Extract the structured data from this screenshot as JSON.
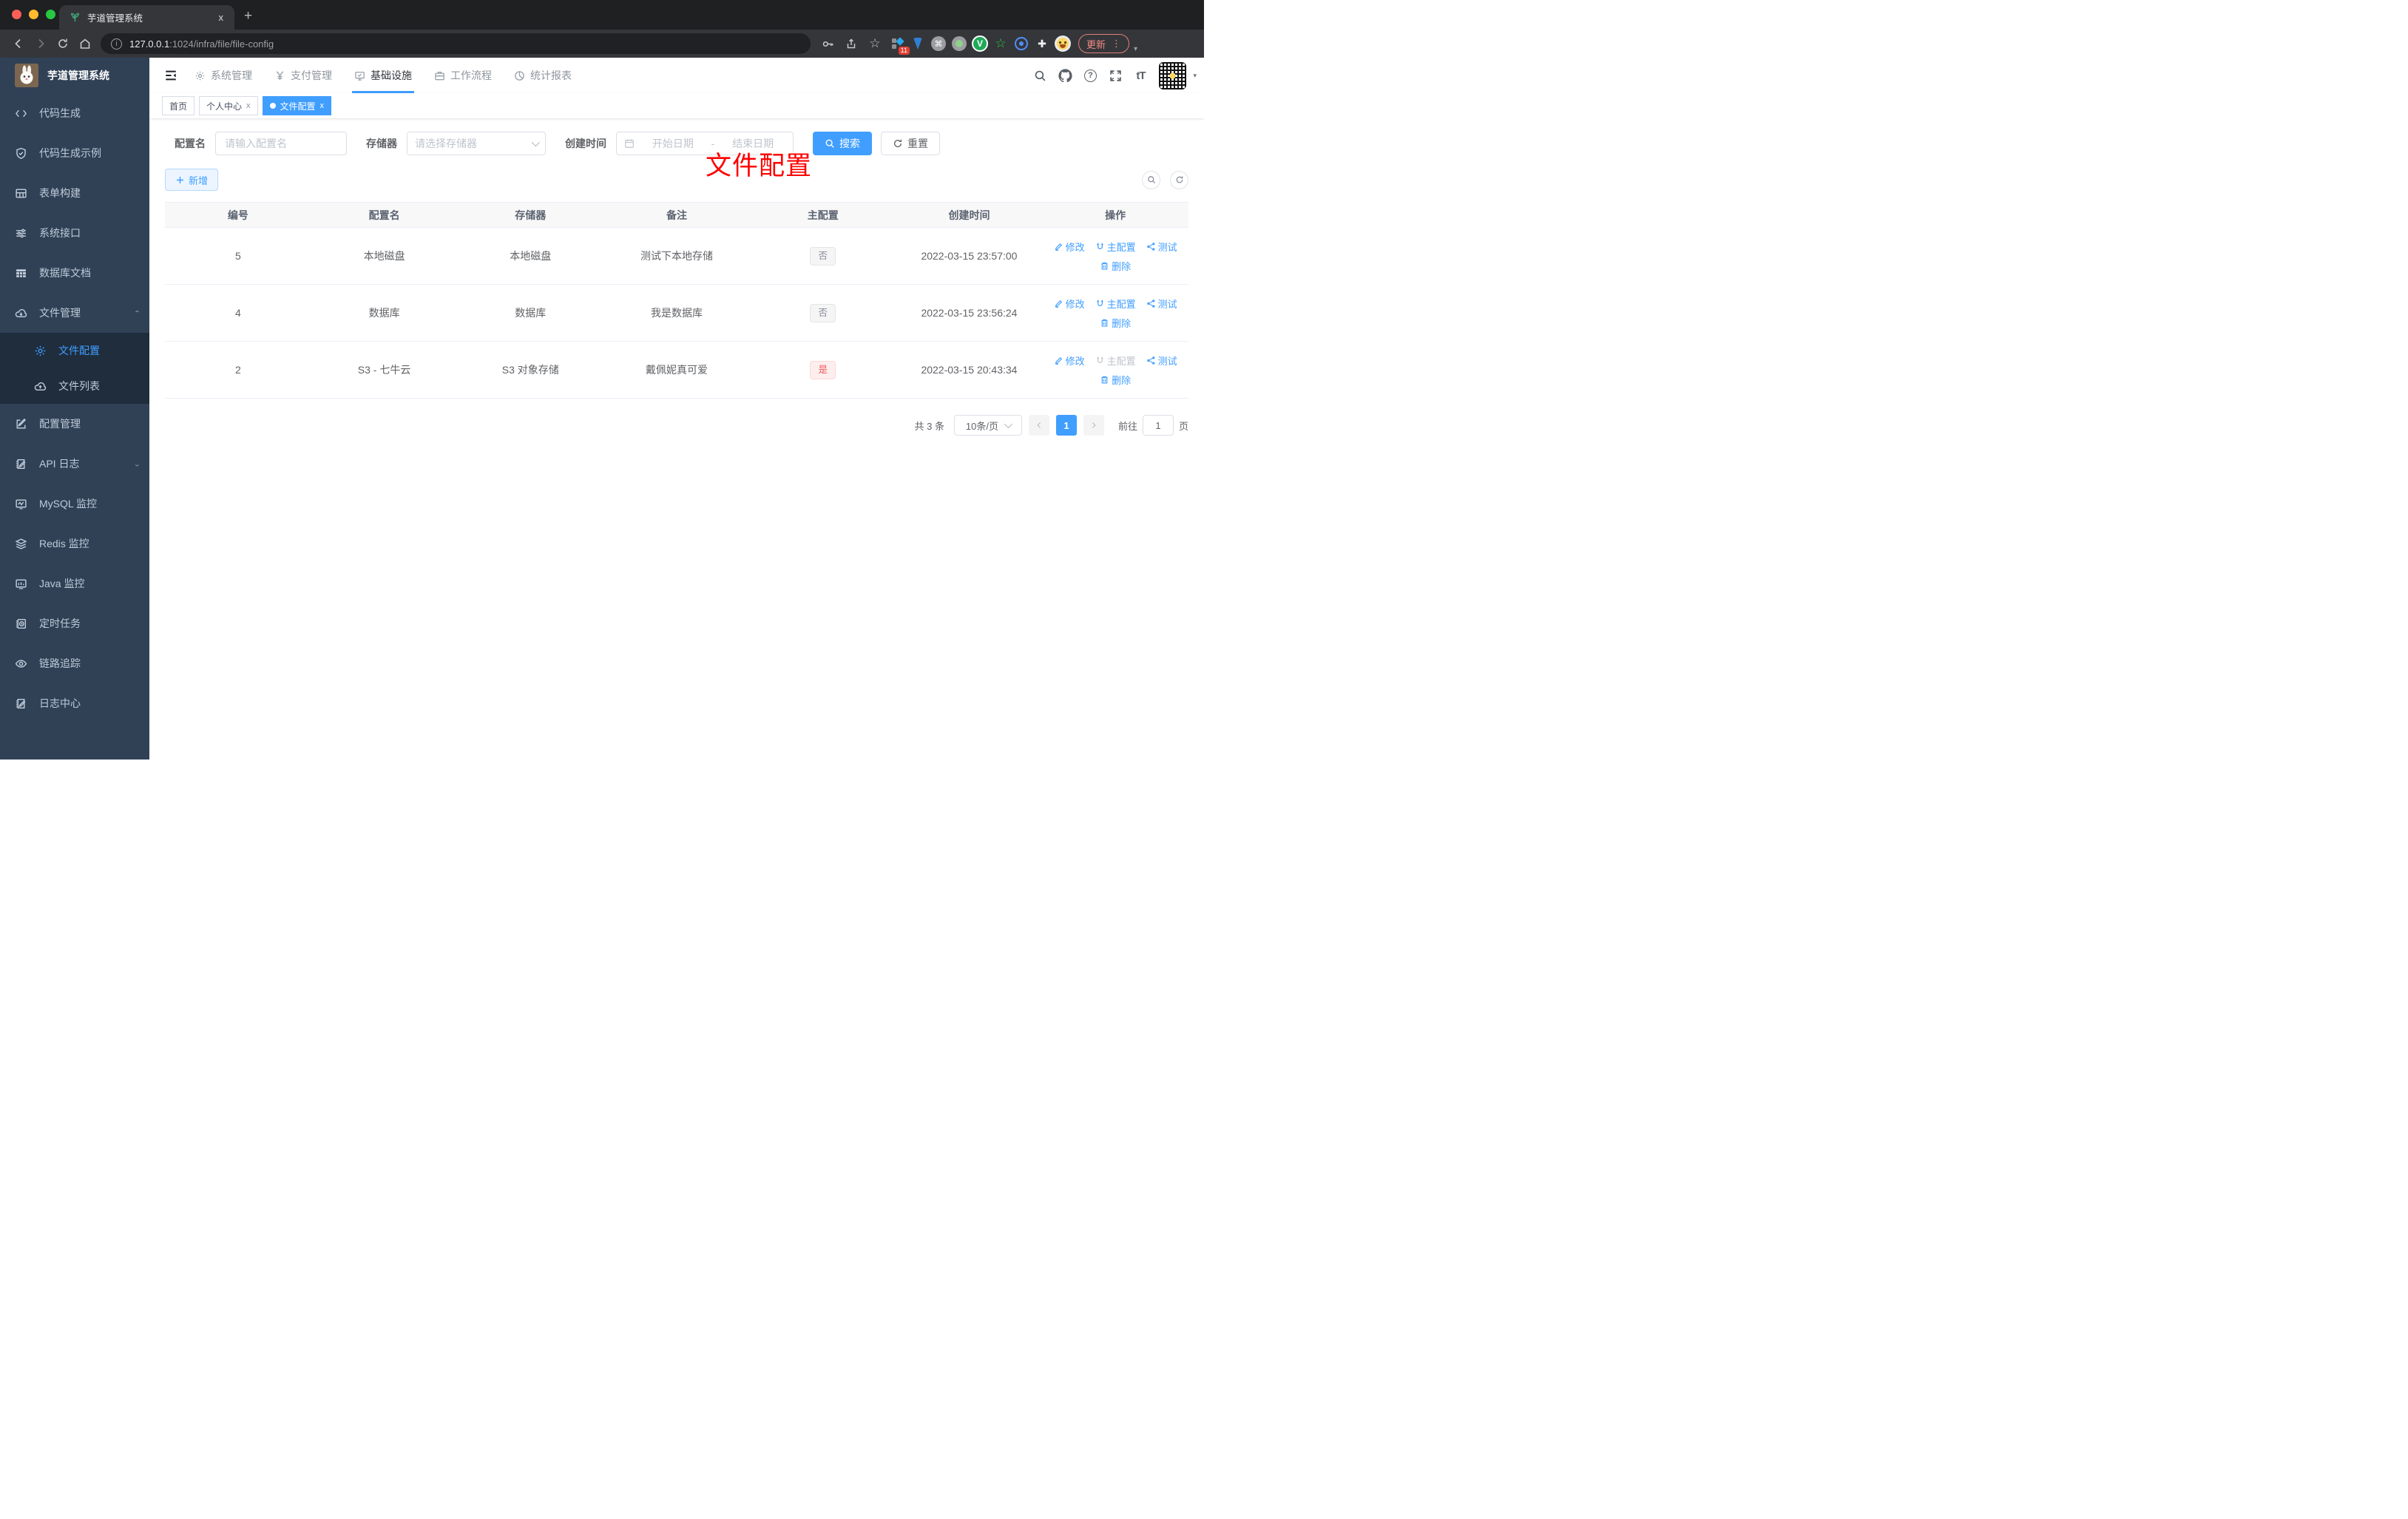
{
  "browser": {
    "tab_title": "芋道管理系统",
    "url_host": "127.0.0.1",
    "url_rest": ":1024/infra/file/file-config",
    "update_button": "更新",
    "extension_badge": "11"
  },
  "icons": {
    "close": "×",
    "plus_tab": "+",
    "info": "i",
    "question": "?",
    "font_size": "tT",
    "dots_vertical": "⋮",
    "caret_down": "▾",
    "star": "☆",
    "cmd": "⌘",
    "v_letter": "V",
    "puzzle": "✚",
    "tab_close": "x"
  },
  "app": {
    "logo_title": "芋道管理系统",
    "topnav": [
      {
        "label": "系统管理"
      },
      {
        "label": "支付管理"
      },
      {
        "label": "基础设施",
        "active": true
      },
      {
        "label": "工作流程"
      },
      {
        "label": "统计报表"
      }
    ]
  },
  "sidebar": {
    "items": [
      {
        "label": "代码生成"
      },
      {
        "label": "代码生成示例"
      },
      {
        "label": "表单构建"
      },
      {
        "label": "系统接口"
      },
      {
        "label": "数据库文档"
      },
      {
        "label": "文件管理",
        "expanded": true,
        "children": [
          {
            "label": "文件配置",
            "active": true
          },
          {
            "label": "文件列表"
          }
        ]
      },
      {
        "label": "配置管理"
      },
      {
        "label": "API 日志",
        "collapsed_group": true
      },
      {
        "label": "MySQL 监控"
      },
      {
        "label": "Redis 监控"
      },
      {
        "label": "Java 监控"
      },
      {
        "label": "定时任务"
      },
      {
        "label": "链路追踪"
      },
      {
        "label": "日志中心"
      }
    ]
  },
  "tabs": [
    {
      "label": "首页",
      "closable": false
    },
    {
      "label": "个人中心",
      "closable": true
    },
    {
      "label": "文件配置",
      "closable": true,
      "active": true
    }
  ],
  "annotation": "文件配置",
  "filters": {
    "name_label": "配置名",
    "name_placeholder": "请输入配置名",
    "storage_label": "存储器",
    "storage_placeholder": "请选择存储器",
    "date_label": "创建时间",
    "date_start": "开始日期",
    "date_sep": "-",
    "date_end": "结束日期",
    "search": "搜索",
    "reset": "重置"
  },
  "toolbar": {
    "add": "新增"
  },
  "table": {
    "columns": [
      "编号",
      "配置名",
      "存储器",
      "备注",
      "主配置",
      "创建时间",
      "操作"
    ],
    "actions": {
      "edit": "修改",
      "master": "主配置",
      "test": "测试",
      "delete": "删除"
    },
    "rows": [
      {
        "id": "5",
        "name": "本地磁盘",
        "storage": "本地磁盘",
        "remark": "测试下本地存储",
        "primary": "否",
        "created": "2022-03-15 23:57:00",
        "master_disabled": false
      },
      {
        "id": "4",
        "name": "数据库",
        "storage": "数据库",
        "remark": "我是数据库",
        "primary": "否",
        "created": "2022-03-15 23:56:24",
        "master_disabled": false
      },
      {
        "id": "2",
        "name": "S3 - 七牛云",
        "storage": "S3 对象存储",
        "remark": "戴佩妮真可爱",
        "primary": "是",
        "created": "2022-03-15 20:43:34",
        "master_disabled": true
      }
    ]
  },
  "pagination": {
    "total": "共 3 条",
    "page_size": "10条/页",
    "page": "1",
    "goto_label": "前往",
    "goto_value": "1",
    "page_suffix": "页"
  },
  "colors": {
    "accent": "#409eff",
    "danger": "#f56c6c",
    "sidebar_bg": "#304156",
    "annotation": "#fe0000"
  }
}
